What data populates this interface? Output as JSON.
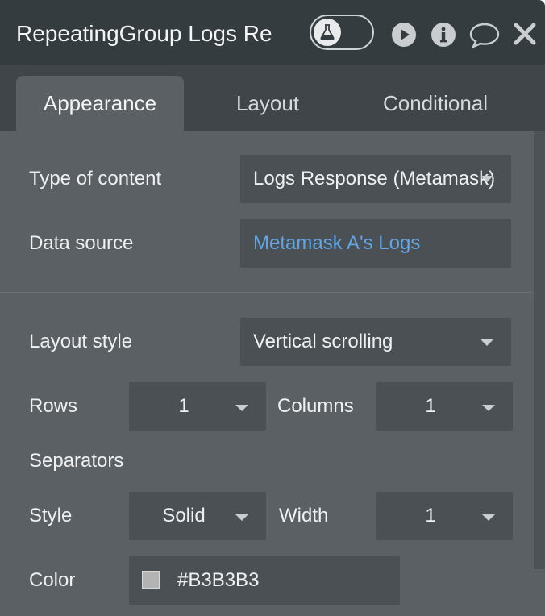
{
  "header": {
    "title": "RepeatingGroup Logs Re",
    "icons": [
      "flask-icon",
      "play-icon",
      "info-icon",
      "comment-icon",
      "close-icon"
    ]
  },
  "tabs": [
    {
      "label": "Appearance",
      "active": true
    },
    {
      "label": "Layout",
      "active": false
    },
    {
      "label": "Conditional",
      "active": false
    }
  ],
  "form": {
    "type_of_content": {
      "label": "Type of content",
      "value": "Logs Response (Metamask)"
    },
    "data_source": {
      "label": "Data source",
      "value": "Metamask A's Logs"
    },
    "layout_style": {
      "label": "Layout style",
      "value": "Vertical scrolling"
    },
    "rows": {
      "label": "Rows",
      "value": "1"
    },
    "columns": {
      "label": "Columns",
      "value": "1"
    },
    "separators": {
      "label": "Separators"
    },
    "style": {
      "label": "Style",
      "value": "Solid"
    },
    "width": {
      "label": "Width",
      "value": "1"
    },
    "color": {
      "label": "Color",
      "value": "#B3B3B3",
      "swatch": "#B3B3B3"
    }
  },
  "colors": {
    "panel_bg": "#5b6064",
    "header_bg": "#353c40",
    "tabbar_bg": "#3f4549",
    "field_bg": "#4a5054",
    "link": "#5fa6e8"
  }
}
